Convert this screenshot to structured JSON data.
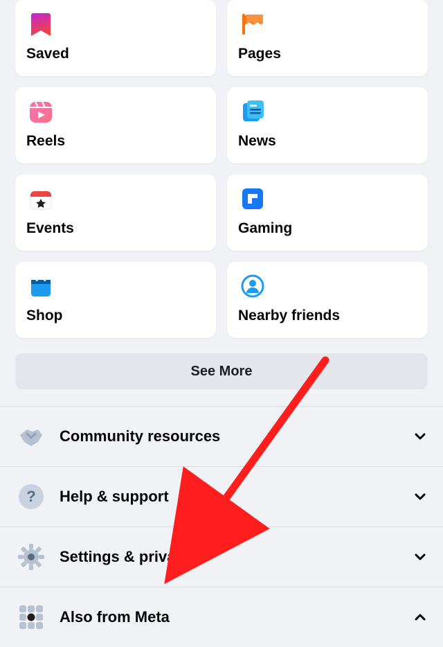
{
  "shortcuts": [
    {
      "key": "saved",
      "label": "Saved"
    },
    {
      "key": "pages",
      "label": "Pages"
    },
    {
      "key": "reels",
      "label": "Reels"
    },
    {
      "key": "news",
      "label": "News"
    },
    {
      "key": "events",
      "label": "Events"
    },
    {
      "key": "gaming",
      "label": "Gaming"
    },
    {
      "key": "shop",
      "label": "Shop"
    },
    {
      "key": "nearby",
      "label": "Nearby friends"
    }
  ],
  "see_more_label": "See More",
  "sections": [
    {
      "key": "community",
      "label": "Community resources",
      "expanded": false
    },
    {
      "key": "help",
      "label": "Help & support",
      "expanded": false
    },
    {
      "key": "settings",
      "label": "Settings & privacy",
      "expanded": false
    },
    {
      "key": "meta",
      "label": "Also from Meta",
      "expanded": true
    }
  ],
  "annotation": {
    "type": "arrow",
    "points_to": "settings"
  }
}
